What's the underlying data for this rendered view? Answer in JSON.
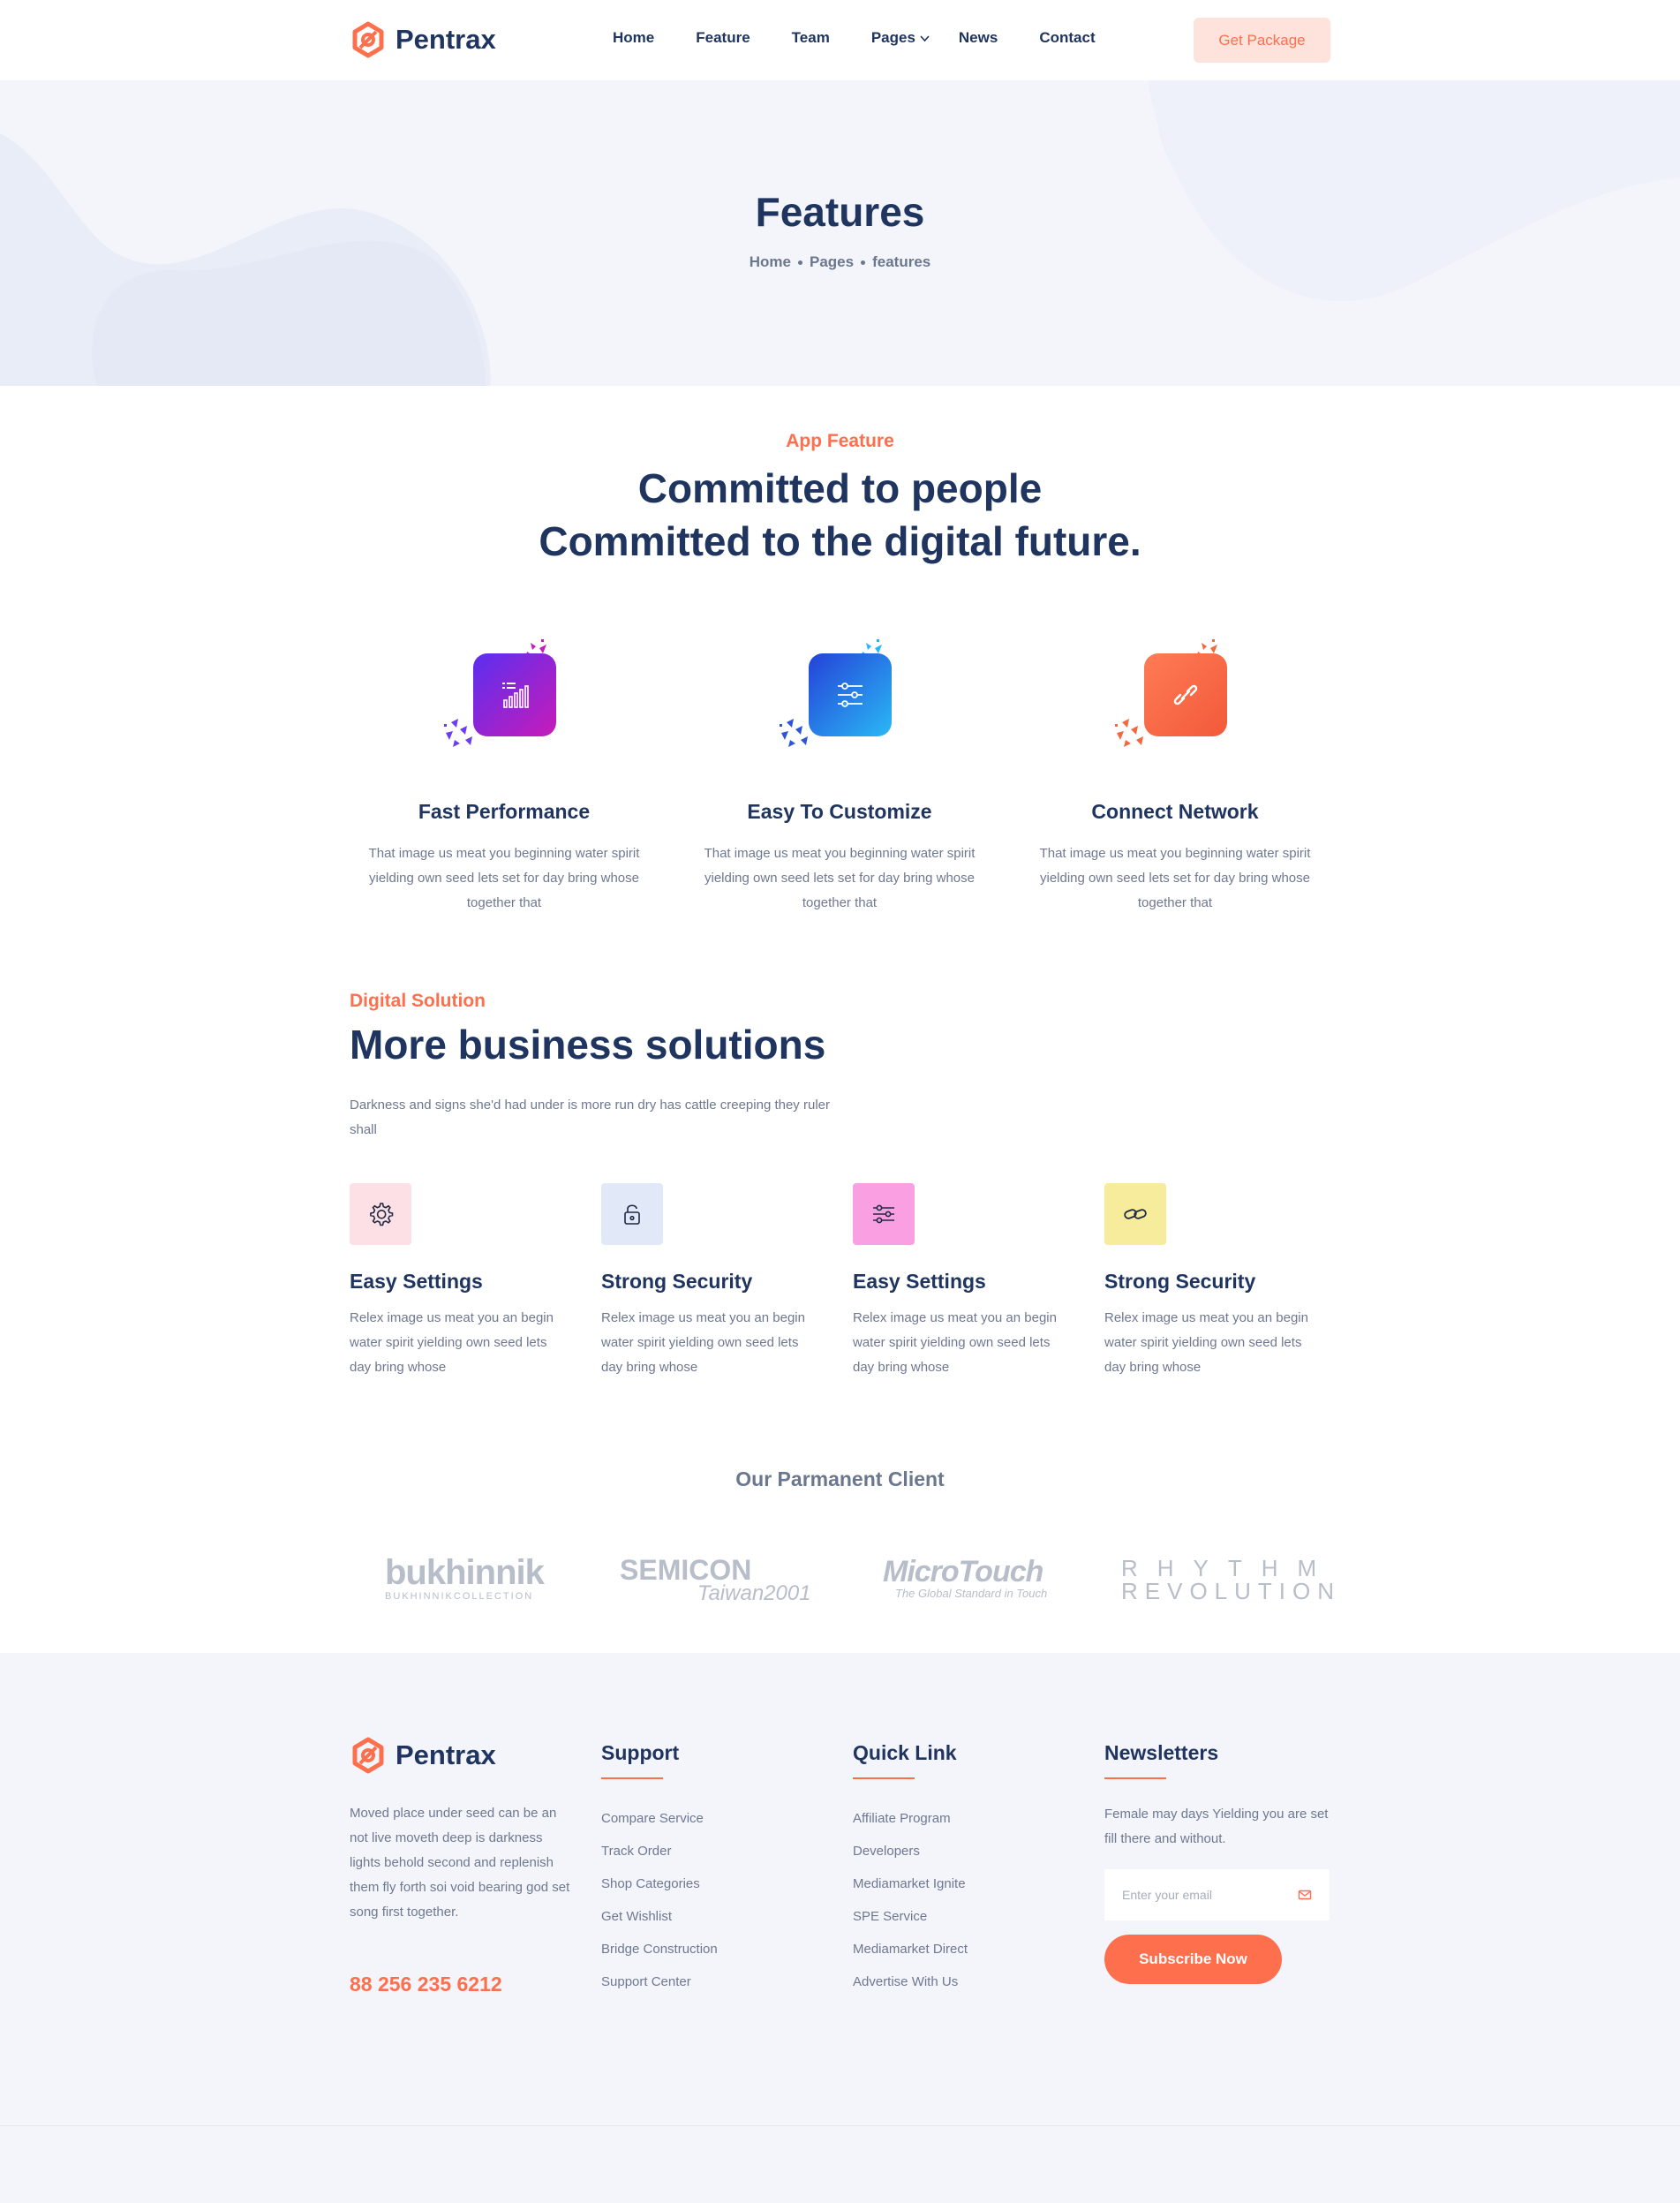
{
  "brand": {
    "name": "Pentrax",
    "accent": "#fd6f4d",
    "navy": "#1f3560"
  },
  "nav": {
    "items": [
      "Home",
      "Feature",
      "Team",
      "Pages",
      "News",
      "Contact"
    ],
    "cta": "Get Package"
  },
  "hero": {
    "title": "Features",
    "breadcrumb": [
      "Home",
      "Pages",
      "features"
    ]
  },
  "app_feature": {
    "eyebrow": "App Feature",
    "title_line1": "Committed to people",
    "title_line2": "Committed to the digital future.",
    "features": [
      {
        "icon": "chart-icon",
        "title": "Fast Performance",
        "desc": "That image us meat you beginning water spirit yielding own seed lets set for day bring whose together that"
      },
      {
        "icon": "sliders-icon",
        "title": "Easy To Customize",
        "desc": "That image us meat you beginning water spirit yielding own seed lets set for day bring whose together that"
      },
      {
        "icon": "link-icon",
        "title": "Connect Network",
        "desc": "That image us meat you beginning water spirit yielding own seed lets set for day bring whose together that"
      }
    ]
  },
  "digital_solution": {
    "eyebrow": "Digital Solution",
    "title": "More business solutions",
    "desc": "Darkness and signs she'd had under is more run dry has cattle creeping they ruler shall",
    "services": [
      {
        "icon": "gear-icon",
        "color": "#fde0e6",
        "title": "Easy Settings",
        "desc": "Relex image us meat you an begin water spirit yielding own seed lets day bring whose"
      },
      {
        "icon": "lock-icon",
        "color": "#e1e9f8",
        "title": "Strong Security",
        "desc": "Relex image us meat you an begin water spirit yielding own seed lets day bring whose"
      },
      {
        "icon": "sliders-icon",
        "color": "#fb9fe3",
        "title": "Easy Settings",
        "desc": "Relex image us meat you an begin water spirit yielding own seed lets day bring whose"
      },
      {
        "icon": "link-icon",
        "color": "#f6ec9b",
        "title": "Strong Security",
        "desc": "Relex image us meat you an begin water spirit yielding own seed lets day bring whose"
      }
    ]
  },
  "clients": {
    "title": "Our Parmanent Client",
    "logos": [
      {
        "main": "bukhinnik",
        "sub": "BUKHINNIKCOLLECTION"
      },
      {
        "main": "SEMICON",
        "sub": "Taiwan2001"
      },
      {
        "main": "MicroTouch",
        "sub": "The Global Standard in Touch"
      },
      {
        "main": "RHYTHM",
        "sub": "REVOLUTION"
      }
    ]
  },
  "footer": {
    "about": "Moved place under seed can be an not live moveth deep is darkness lights behold second and replenish them fly forth soi void bearing god set song first together.",
    "phone": "88 256 235 6212",
    "support": {
      "title": "Support",
      "links": [
        "Compare Service",
        "Track Order",
        "Shop Categories",
        "Get Wishlist",
        "Bridge Construction",
        "Support Center"
      ]
    },
    "quick_link": {
      "title": "Quick Link",
      "links": [
        "Affiliate Program",
        "Developers",
        "Mediamarket Ignite",
        "SPE Service",
        "Mediamarket Direct",
        "Advertise With Us"
      ]
    },
    "newsletter": {
      "title": "Newsletters",
      "desc": "Female may days Yielding you are set fill there and without.",
      "placeholder": "Enter your email",
      "button": "Subscribe Now"
    }
  }
}
